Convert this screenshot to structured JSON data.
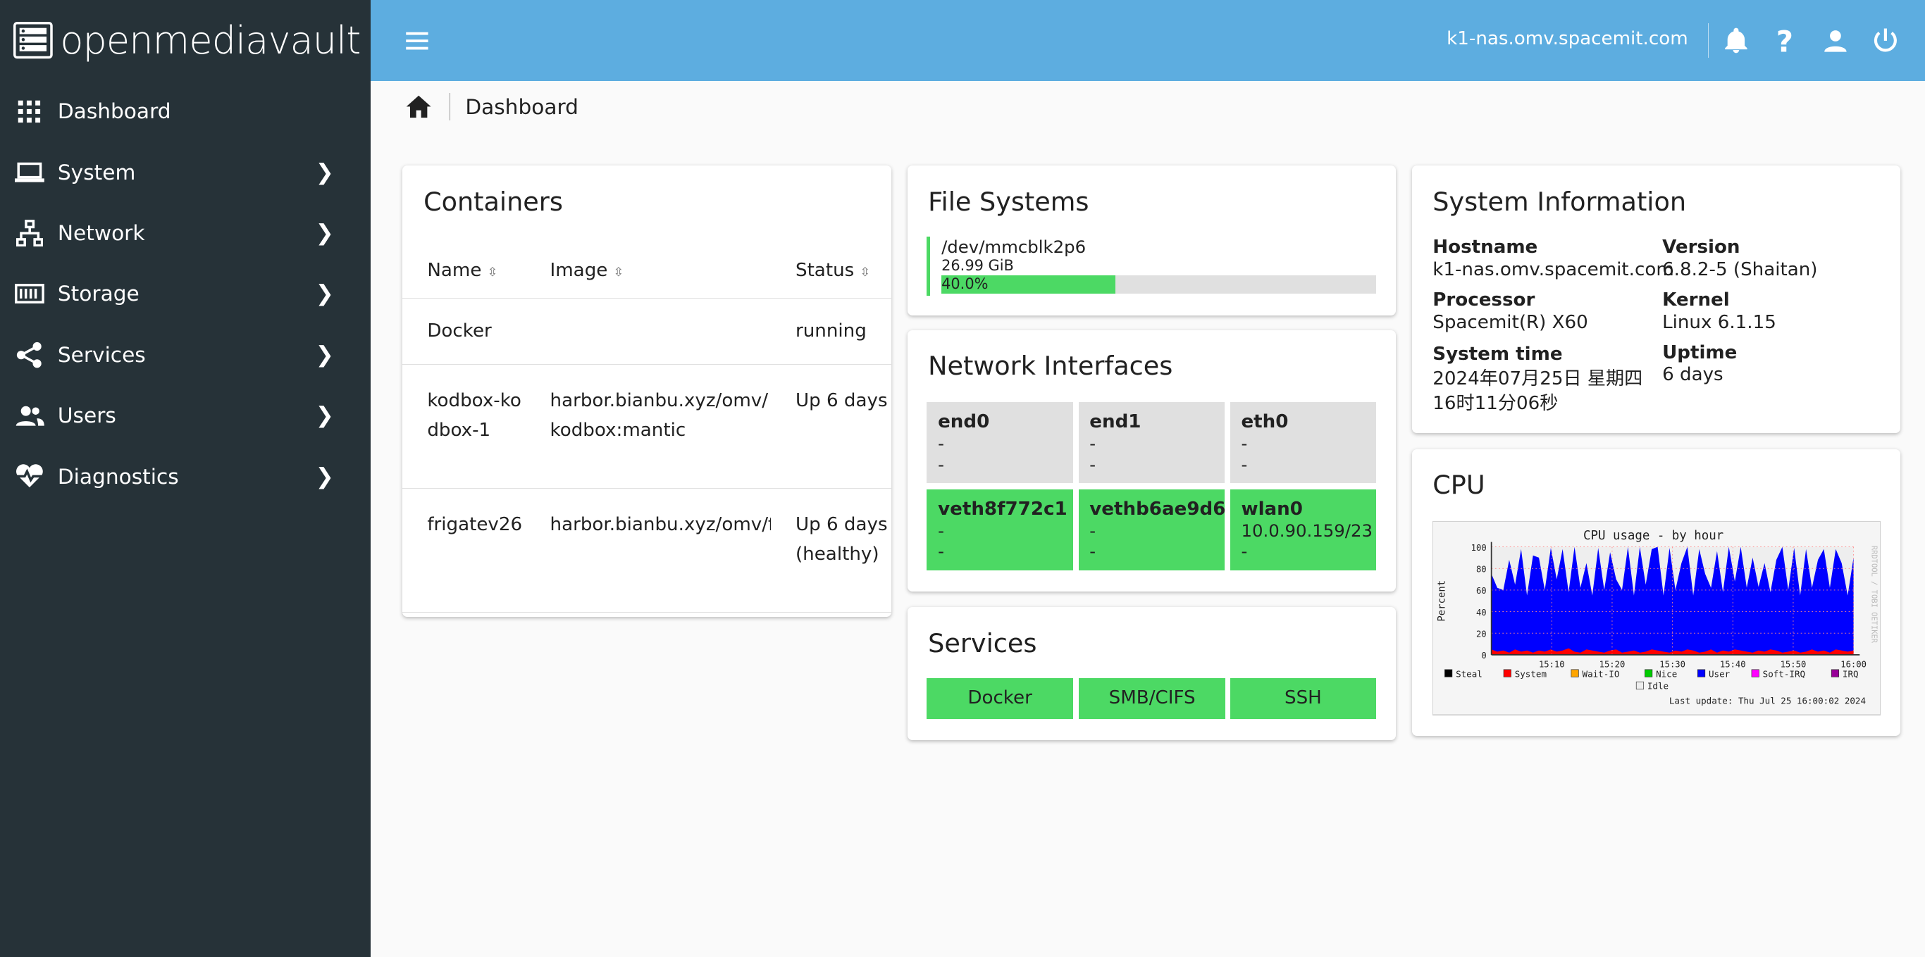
{
  "app": {
    "name": "openmediavault"
  },
  "sidebar": {
    "items": [
      {
        "label": "Dashboard",
        "icon": "grid-icon"
      },
      {
        "label": "System",
        "icon": "laptop-icon"
      },
      {
        "label": "Network",
        "icon": "network-icon"
      },
      {
        "label": "Storage",
        "icon": "storage-icon"
      },
      {
        "label": "Services",
        "icon": "share-icon"
      },
      {
        "label": "Users",
        "icon": "users-icon"
      },
      {
        "label": "Diagnostics",
        "icon": "heartbeat-icon"
      }
    ]
  },
  "topbar": {
    "hostname": "k1-nas.omv.spacemit.com",
    "color": "#5dade0"
  },
  "breadcrumb": {
    "current": "Dashboard"
  },
  "containers": {
    "title": "Containers",
    "columns": [
      "Name",
      "Image",
      "Status"
    ],
    "rows": [
      {
        "name": "Docker",
        "image": "",
        "status": "running"
      },
      {
        "name": "kodbox-kodbox-1",
        "image": "harbor.bianbu.xyz/omv/kodbox:mantic",
        "status": "Up 6 days"
      },
      {
        "name": "frigatev26",
        "image": "harbor.bianbu.xyz/omv/frigate",
        "status": "Up 6 days (healthy)"
      }
    ]
  },
  "filesystems": {
    "title": "File Systems",
    "items": [
      {
        "device": "/dev/mmcblk2p6",
        "size": "26.99 GiB",
        "used_label": "40.0%",
        "used_percent": 40
      }
    ]
  },
  "network": {
    "title": "Network Interfaces",
    "items": [
      {
        "name": "end0",
        "line1": "-",
        "line2": "-",
        "state": "down"
      },
      {
        "name": "end1",
        "line1": "-",
        "line2": "-",
        "state": "down"
      },
      {
        "name": "eth0",
        "line1": "-",
        "line2": "-",
        "state": "down"
      },
      {
        "name": "veth8f772c1",
        "line1": "-",
        "line2": "-",
        "state": "up"
      },
      {
        "name": "vethb6ae9d6",
        "line1": "-",
        "line2": "-",
        "state": "up"
      },
      {
        "name": "wlan0",
        "line1": "10.0.90.159/23",
        "line2": "-",
        "state": "up"
      }
    ]
  },
  "services": {
    "title": "Services",
    "items": [
      "Docker",
      "SMB/CIFS",
      "SSH"
    ]
  },
  "sysinfo": {
    "title": "System Information",
    "hostname_label": "Hostname",
    "hostname": "k1-nas.omv.spacemit.com",
    "version_label": "Version",
    "version": "6.8.2-5 (Shaitan)",
    "processor_label": "Processor",
    "processor": "Spacemit(R) X60",
    "kernel_label": "Kernel",
    "kernel": "Linux 6.1.15",
    "time_label": "System time",
    "time_line1": "2024年07月25日 星期四",
    "time_line2": "16时11分06秒",
    "uptime_label": "Uptime",
    "uptime": "6 days"
  },
  "cpu": {
    "title": "CPU"
  },
  "chart_data": {
    "type": "area",
    "title": "CPU usage - by hour",
    "ylabel": "Percent",
    "ylim": [
      0,
      100
    ],
    "yticks": [
      "0",
      "20",
      "40",
      "60",
      "80",
      "100"
    ],
    "xticks": [
      "15:10",
      "15:20",
      "15:30",
      "15:40",
      "15:50",
      "16:00"
    ],
    "watermark": "RRDTOOL / TOBI OETIKER",
    "legend": [
      "Steal",
      "System",
      "Wait-IO",
      "Nice",
      "User",
      "Soft-IRQ",
      "IRQ",
      "Idle"
    ],
    "legend_colors": [
      "#000000",
      "#ff0000",
      "#ffa500",
      "#00cc00",
      "#0000ff",
      "#ff00ff",
      "#990099",
      "#eeeeee"
    ],
    "last_update": "Last update: Thu Jul 25 16:00:02 2024",
    "user": [
      75,
      62,
      60,
      88,
      65,
      98,
      55,
      92,
      90,
      60,
      99,
      70,
      98,
      58,
      100,
      62,
      85,
      55,
      99,
      60,
      95,
      70,
      60,
      100,
      55,
      100,
      65,
      98,
      100,
      55,
      99,
      60,
      85,
      100,
      55,
      98,
      75,
      62,
      96,
      58,
      100,
      68,
      100,
      62,
      90,
      63,
      85,
      58,
      88,
      100,
      60,
      99,
      55,
      98,
      62,
      88,
      98,
      62,
      98,
      85,
      55,
      90
    ],
    "system": [
      5,
      3,
      4,
      2,
      5,
      3,
      4,
      2,
      4,
      3,
      5,
      3,
      4,
      6,
      3,
      2,
      5,
      4,
      3,
      2,
      4,
      5,
      2,
      3,
      4,
      2,
      3,
      5,
      4,
      3,
      2,
      4,
      3,
      5,
      4,
      2,
      3,
      5,
      2,
      4,
      3,
      5,
      4,
      3,
      2,
      4,
      3,
      5,
      4,
      2,
      3,
      4,
      2,
      3,
      5,
      3,
      4,
      2,
      5,
      4,
      3,
      4
    ]
  }
}
